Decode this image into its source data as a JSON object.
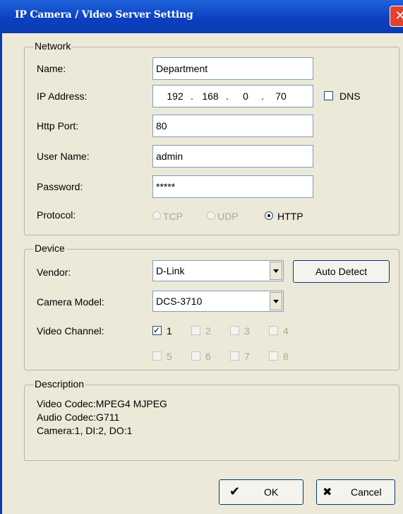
{
  "window": {
    "title": "IP Camera / Video Server Setting",
    "close_glyph": "✕"
  },
  "network": {
    "legend": "Network",
    "name_label": "Name:",
    "name_value": "Department",
    "ip_label": "IP Address:",
    "ip_octets": [
      "192",
      "168",
      "0",
      "70"
    ],
    "ip_separator": ".",
    "dns_label": "DNS",
    "dns_checked": false,
    "port_label": "Http Port:",
    "port_value": "80",
    "user_label": "User Name:",
    "user_value": "admin",
    "password_label": "Password:",
    "password_value": "*****",
    "protocol_label": "Protocol:",
    "protocols": [
      {
        "label": "TCP",
        "selected": false,
        "enabled": false
      },
      {
        "label": "UDP",
        "selected": false,
        "enabled": false
      },
      {
        "label": "HTTP",
        "selected": true,
        "enabled": true
      }
    ]
  },
  "device": {
    "legend": "Device",
    "vendor_label": "Vendor:",
    "vendor_value": "D-Link",
    "auto_detect_label": "Auto Detect",
    "model_label": "Camera Model:",
    "model_value": "DCS-3710",
    "channel_label": "Video Channel:",
    "channels": [
      {
        "label": "1",
        "checked": true,
        "enabled": true
      },
      {
        "label": "2",
        "checked": false,
        "enabled": false
      },
      {
        "label": "3",
        "checked": false,
        "enabled": false
      },
      {
        "label": "4",
        "checked": false,
        "enabled": false
      },
      {
        "label": "5",
        "checked": false,
        "enabled": false
      },
      {
        "label": "6",
        "checked": false,
        "enabled": false
      },
      {
        "label": "7",
        "checked": false,
        "enabled": false
      },
      {
        "label": "8",
        "checked": false,
        "enabled": false
      }
    ]
  },
  "description": {
    "legend": "Description",
    "lines": [
      "Video Codec:MPEG4 MJPEG",
      "Audio Codec:G711",
      "Camera:1, DI:2, DO:1"
    ]
  },
  "buttons": {
    "ok_label": "OK",
    "ok_icon": "✔",
    "cancel_label": "Cancel",
    "cancel_icon": "✖"
  },
  "colors": {
    "title_bar": "#0A3FBE",
    "dialog_bg": "#ECE9D8",
    "close_button": "#E0432E",
    "button_border": "#003C74"
  }
}
